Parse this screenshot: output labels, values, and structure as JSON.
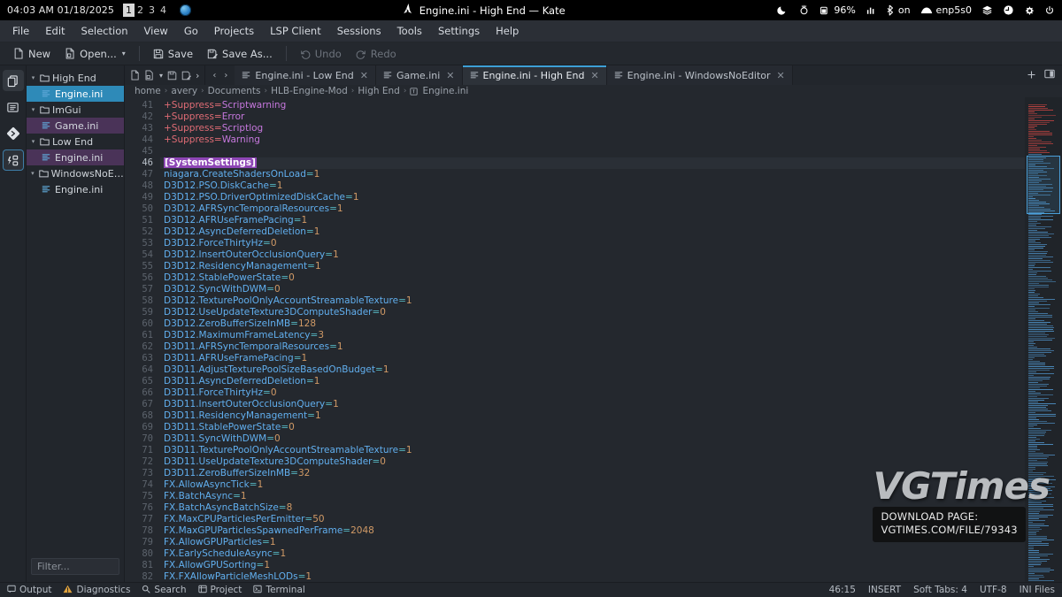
{
  "system_panel": {
    "clock": "04:03 AM 01/18/2025",
    "desktops": [
      "1",
      "2",
      "3",
      "4"
    ],
    "active_desktop": "1",
    "globe_icon": "globe-icon",
    "window_title": "Engine.ini - High End  — Kate",
    "distro_icon": "arch-logo-icon",
    "tray": [
      {
        "icon": "moon-icon",
        "label": ""
      },
      {
        "icon": "brightness-icon",
        "label": ""
      },
      {
        "icon": "battery-icon",
        "label": "96%"
      },
      {
        "icon": "audio-levels-icon",
        "label": ""
      },
      {
        "icon": "bluetooth-icon",
        "label": "on"
      },
      {
        "icon": "network-icon",
        "label": "enp5s0"
      },
      {
        "icon": "layers-icon",
        "label": ""
      },
      {
        "icon": "clock-icon",
        "label": ""
      },
      {
        "icon": "gear-icon",
        "label": ""
      },
      {
        "icon": "power-icon",
        "label": ""
      }
    ]
  },
  "menubar": {
    "items": [
      "File",
      "Edit",
      "Selection",
      "View",
      "Go",
      "Projects",
      "LSP Client",
      "Sessions",
      "Tools",
      "Settings",
      "Help"
    ]
  },
  "toolbar": {
    "new_label": "New",
    "open_label": "Open...",
    "save_label": "Save",
    "save_as_label": "Save As...",
    "undo_label": "Undo",
    "redo_label": "Redo"
  },
  "activity_bar": {
    "items": [
      {
        "icon": "documents-icon",
        "state": "active"
      },
      {
        "icon": "list-icon",
        "state": "normal"
      },
      {
        "icon": "git-branch-icon",
        "state": "normal"
      },
      {
        "icon": "structure-icon",
        "state": "selected"
      }
    ]
  },
  "sidebar": {
    "tree": [
      {
        "type": "folder",
        "label": "High End",
        "twist": "v",
        "state": "normal"
      },
      {
        "type": "file",
        "label": "Engine.ini",
        "state": "selected"
      },
      {
        "type": "folder",
        "label": "ImGui",
        "twist": "v",
        "state": "normal"
      },
      {
        "type": "file",
        "label": "Game.ini",
        "state": "modified"
      },
      {
        "type": "folder",
        "label": "Low End",
        "twist": "v",
        "state": "normal"
      },
      {
        "type": "file",
        "label": "Engine.ini",
        "state": "modified"
      },
      {
        "type": "folder",
        "label": "WindowsNoEditor",
        "twist": "v",
        "state": "normal"
      },
      {
        "type": "file",
        "label": "Engine.ini",
        "state": "normal"
      }
    ],
    "filter_placeholder": "Filter..."
  },
  "tabs": [
    {
      "label": "Engine.ini - Low End",
      "active": false
    },
    {
      "label": "Game.ini",
      "active": false
    },
    {
      "label": "Engine.ini - High End",
      "active": true
    },
    {
      "label": "Engine.ini - WindowsNoEditor",
      "active": false
    }
  ],
  "breadcrumb": {
    "items": [
      "home",
      "avery",
      "Documents",
      "HLB-Engine-Mod",
      "High End",
      "Engine.ini"
    ],
    "separator": "›"
  },
  "editor": {
    "first_line_number": 41,
    "current_line_number": 46,
    "lines": [
      {
        "n": 41,
        "type": "suppress",
        "key": "+Suppress=",
        "value": "Scriptwarning"
      },
      {
        "n": 42,
        "type": "suppress",
        "key": "+Suppress=",
        "value": "Error"
      },
      {
        "n": 43,
        "type": "suppress",
        "key": "+Suppress=",
        "value": "Scriptlog"
      },
      {
        "n": 44,
        "type": "suppress",
        "key": "+Suppress=",
        "value": "Warning"
      },
      {
        "n": 45,
        "type": "blank",
        "key": "",
        "value": ""
      },
      {
        "n": 46,
        "type": "section",
        "key": "[SystemSettings]",
        "value": ""
      },
      {
        "n": 47,
        "type": "kv",
        "key": "niagara.CreateShadersOnLoad",
        "value": "1"
      },
      {
        "n": 48,
        "type": "kv",
        "key": "D3D12.PSO.DiskCache",
        "value": "1"
      },
      {
        "n": 49,
        "type": "kv",
        "key": "D3D12.PSO.DriverOptimizedDiskCache",
        "value": "1"
      },
      {
        "n": 50,
        "type": "kv",
        "key": "D3D12.AFRSyncTemporalResources",
        "value": "1"
      },
      {
        "n": 51,
        "type": "kv",
        "key": "D3D12.AFRUseFramePacing",
        "value": "1"
      },
      {
        "n": 52,
        "type": "kv",
        "key": "D3D12.AsyncDeferredDeletion",
        "value": "1"
      },
      {
        "n": 53,
        "type": "kv",
        "key": "D3D12.ForceThirtyHz",
        "value": "0"
      },
      {
        "n": 54,
        "type": "kv",
        "key": "D3D12.InsertOuterOcclusionQuery",
        "value": "1"
      },
      {
        "n": 55,
        "type": "kv",
        "key": "D3D12.ResidencyManagement",
        "value": "1"
      },
      {
        "n": 56,
        "type": "kv",
        "key": "D3D12.StablePowerState",
        "value": "0"
      },
      {
        "n": 57,
        "type": "kv",
        "key": "D3D12.SyncWithDWM",
        "value": "0"
      },
      {
        "n": 58,
        "type": "kv",
        "key": "D3D12.TexturePoolOnlyAccountStreamableTexture",
        "value": "1"
      },
      {
        "n": 59,
        "type": "kv",
        "key": "D3D12.UseUpdateTexture3DComputeShader",
        "value": "0"
      },
      {
        "n": 60,
        "type": "kv",
        "key": "D3D12.ZeroBufferSizeInMB",
        "value": "128"
      },
      {
        "n": 61,
        "type": "kv",
        "key": "D3D12.MaximumFrameLatency",
        "value": "3"
      },
      {
        "n": 62,
        "type": "kv",
        "key": "D3D11.AFRSyncTemporalResources",
        "value": "1"
      },
      {
        "n": 63,
        "type": "kv",
        "key": "D3D11.AFRUseFramePacing",
        "value": "1"
      },
      {
        "n": 64,
        "type": "kv",
        "key": "D3D11.AdjustTexturePoolSizeBasedOnBudget",
        "value": "1"
      },
      {
        "n": 65,
        "type": "kv",
        "key": "D3D11.AsyncDeferredDeletion",
        "value": "1"
      },
      {
        "n": 66,
        "type": "kv",
        "key": "D3D11.ForceThirtyHz",
        "value": "0"
      },
      {
        "n": 67,
        "type": "kv",
        "key": "D3D11.InsertOuterOcclusionQuery",
        "value": "1"
      },
      {
        "n": 68,
        "type": "kv",
        "key": "D3D11.ResidencyManagement",
        "value": "1"
      },
      {
        "n": 69,
        "type": "kv",
        "key": "D3D11.StablePowerState",
        "value": "0"
      },
      {
        "n": 70,
        "type": "kv",
        "key": "D3D11.SyncWithDWM",
        "value": "0"
      },
      {
        "n": 71,
        "type": "kv",
        "key": "D3D11.TexturePoolOnlyAccountStreamableTexture",
        "value": "1"
      },
      {
        "n": 72,
        "type": "kv",
        "key": "D3D11.UseUpdateTexture3DComputeShader",
        "value": "0"
      },
      {
        "n": 73,
        "type": "kv",
        "key": "D3D11.ZeroBufferSizeInMB",
        "value": "32"
      },
      {
        "n": 74,
        "type": "kv",
        "key": "FX.AllowAsyncTick",
        "value": "1"
      },
      {
        "n": 75,
        "type": "kv",
        "key": "FX.BatchAsync",
        "value": "1"
      },
      {
        "n": 76,
        "type": "kv",
        "key": "FX.BatchAsyncBatchSize",
        "value": "8"
      },
      {
        "n": 77,
        "type": "kv",
        "key": "FX.MaxCPUParticlesPerEmitter",
        "value": "50"
      },
      {
        "n": 78,
        "type": "kv",
        "key": "FX.MaxGPUParticlesSpawnedPerFrame",
        "value": "2048"
      },
      {
        "n": 79,
        "type": "kv",
        "key": "FX.AllowGPUParticles",
        "value": "1"
      },
      {
        "n": 80,
        "type": "kv",
        "key": "FX.EarlyScheduleAsync",
        "value": "1"
      },
      {
        "n": 81,
        "type": "kv",
        "key": "FX.AllowGPUSorting",
        "value": "1"
      },
      {
        "n": 82,
        "type": "kv",
        "key": "FX.FXAllowParticleMeshLODs",
        "value": "1"
      }
    ]
  },
  "watermark": {
    "logo": "VGTimes",
    "line1": "DOWNLOAD PAGE:",
    "line2": "VGTIMES.COM/FILE/79343"
  },
  "statusbar": {
    "left": [
      {
        "icon": "output-icon",
        "label": "Output"
      },
      {
        "icon": "warning-icon",
        "label": "Diagnostics"
      },
      {
        "icon": "search-icon",
        "label": "Search"
      },
      {
        "icon": "project-icon",
        "label": "Project"
      },
      {
        "icon": "terminal-icon",
        "label": "Terminal"
      }
    ],
    "right": [
      {
        "label": "46:15"
      },
      {
        "label": "INSERT"
      },
      {
        "label": "Soft Tabs: 4"
      },
      {
        "label": "UTF-8"
      },
      {
        "label": "INI Files"
      }
    ]
  },
  "colors": {
    "accent": "#3d9fd6",
    "selection": "#2e8ab8",
    "modified": "#4a3358",
    "section": "#8d45b5",
    "background": "#24282e"
  }
}
